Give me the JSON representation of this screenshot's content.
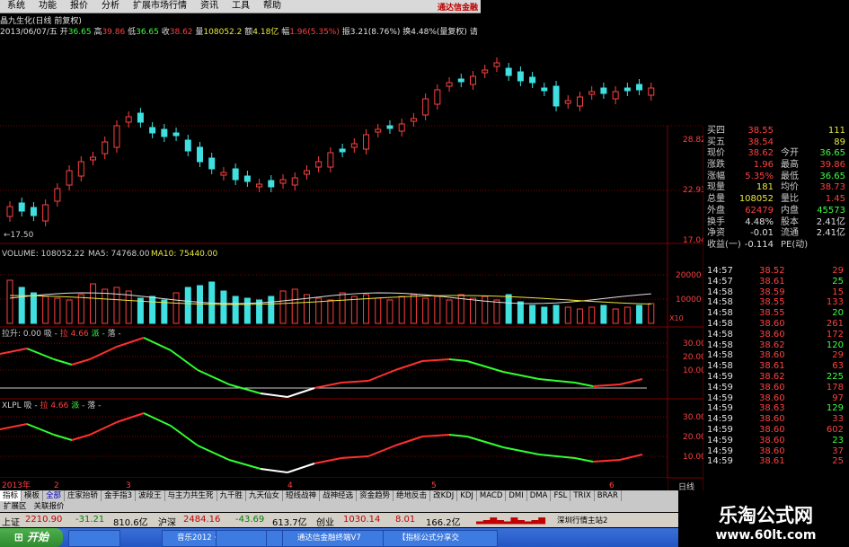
{
  "menu": {
    "items": [
      "系统",
      "功能",
      "报价",
      "分析",
      "扩展市场行情",
      "资讯",
      "工具",
      "帮助"
    ],
    "brand": "通达信金融"
  },
  "infoline": {
    "name": "晶九生化(日线 前复权)",
    "date": "2013/06/07/五",
    "open_label": "开",
    "open": "36.65",
    "high_label": "高",
    "high": "39.86",
    "low_label": "低",
    "low": "36.65",
    "close_label": "收",
    "close": "38.62",
    "vol_label": "量",
    "vol": "108052.2",
    "amt_label": "额",
    "amt": "4.18亿",
    "pct_label": "幅",
    "pct": "1.96(5.35%)",
    "amp_label": "振",
    "amp": "3.21(8.76%)",
    "turn_label": "换",
    "turn": "4.48%(量复权)",
    "extra": "请"
  },
  "price_axis": [
    "28.82",
    "22.93",
    "17.04"
  ],
  "low_label": "←17.50",
  "volume_line": {
    "label": "VOLUME: 108052.22",
    "ma5": "MA5: 74768.00",
    "ma10": "MA10: 75440.00"
  },
  "volume_axis": [
    "20000",
    "10000",
    "X10"
  ],
  "ind1": {
    "label_a": "拉升: 0.00",
    "label_b": "吸 -",
    "label_c": "拉 4.66",
    "label_d": "派 -",
    "label_e": "落 -"
  },
  "ind1_axis": [
    "30.00",
    "20.00",
    "10.00"
  ],
  "ind2": {
    "label_a": "XLPL",
    "label_b": "吸 -",
    "label_c": "拉 4.66",
    "label_d": "派 -",
    "label_e": "落 -"
  },
  "ind2_axis": [
    "30.00",
    "20.00",
    "10.00"
  ],
  "time_axis": [
    "2013年",
    "2",
    "3",
    "4",
    "5",
    "6"
  ],
  "quotes": {
    "rows": [
      {
        "label": "买四",
        "value": "38.55",
        "vol": "111"
      },
      {
        "label": "买五",
        "value": "38.54",
        "vol": "89"
      },
      {
        "label": "现价",
        "value": "38.62",
        "label2": "今开",
        "value2": "36.65"
      },
      {
        "label": "涨跌",
        "value": "1.96",
        "label2": "最高",
        "value2": "39.86"
      },
      {
        "label": "涨幅",
        "value": "5.35%",
        "label2": "最低",
        "value2": "36.65"
      },
      {
        "label": "现量",
        "value": "181",
        "label2": "均价",
        "value2": "38.73"
      },
      {
        "label": "总量",
        "value": "108052",
        "label2": "量比",
        "value2": "1.45"
      },
      {
        "label": "外盘",
        "value": "62479",
        "label2": "内盘",
        "value2": "45573"
      },
      {
        "label": "换手",
        "value": "4.48%",
        "label2": "股本",
        "value2": "2.41亿"
      },
      {
        "label": "净资",
        "value": "-0.01",
        "label2": "流通",
        "value2": "2.41亿"
      },
      {
        "label": "收益(一)",
        "value": "-0.114",
        "label2": "PE(动)",
        "value2": ""
      }
    ]
  },
  "ticks": [
    {
      "time": "14:57",
      "price": "38.52",
      "vol": "29"
    },
    {
      "time": "14:57",
      "price": "38.61",
      "vol": "25"
    },
    {
      "time": "14:58",
      "price": "38.59",
      "vol": "15"
    },
    {
      "time": "14:58",
      "price": "38.55",
      "vol": "133"
    },
    {
      "time": "14:58",
      "price": "38.55",
      "vol": "20"
    },
    {
      "time": "14:58",
      "price": "38.60",
      "vol": "261"
    },
    {
      "time": "14:58",
      "price": "38.60",
      "vol": "172"
    },
    {
      "time": "14:58",
      "price": "38.62",
      "vol": "120"
    },
    {
      "time": "14:58",
      "price": "38.60",
      "vol": "29"
    },
    {
      "time": "14:58",
      "price": "38.61",
      "vol": "63"
    },
    {
      "time": "14:59",
      "price": "38.62",
      "vol": "225"
    },
    {
      "time": "14:59",
      "price": "38.60",
      "vol": "178"
    },
    {
      "time": "14:59",
      "price": "38.60",
      "vol": "97"
    },
    {
      "time": "14:59",
      "price": "38.63",
      "vol": "129"
    },
    {
      "time": "14:59",
      "price": "38.60",
      "vol": "33"
    },
    {
      "time": "14:59",
      "price": "38.60",
      "vol": "602"
    },
    {
      "time": "14:59",
      "price": "38.60",
      "vol": "23"
    },
    {
      "time": "14:59",
      "price": "38.60",
      "vol": "37"
    },
    {
      "time": "14:59",
      "price": "38.61",
      "vol": "25"
    }
  ],
  "tabs": [
    "指标",
    "模板",
    "全部",
    "庄家抬轿",
    "金手指3",
    "波段王",
    "与主力共生死",
    "九千胜",
    "九天仙女",
    "短线战神",
    "战神经选",
    "资金趋势",
    "绝地反击",
    "改KDJ",
    "KDJ",
    "MACD",
    "DMI",
    "DMA",
    "FSL",
    "TRIX",
    "BRAR"
  ],
  "subtabs": [
    "扩展区",
    "关联报价"
  ],
  "status": {
    "sh_label": "上证",
    "sh": "2210.90",
    "sh_chg": "-31.21",
    "sh_amt": "810.6亿",
    "hs_label": "沪深",
    "hs": "2484.16",
    "hs_chg": "-43.69",
    "hs_amt": "613.7亿",
    "cy_label": "创业",
    "cy": "1030.14",
    "cy_chg": "8.01",
    "cy_amt": "166.2亿",
    "server": "深圳行情主站2"
  },
  "taskbar": {
    "start": "开始",
    "tasks": [
      "音乐2012 · 李代沫",
      "",
      "",
      "通达信金融终端V7",
      "【指标公式分享交"
    ]
  },
  "daytab": "日线",
  "watermark": {
    "line1": "乐淘公式网",
    "line2": "www.60lt.com"
  },
  "colors": {
    "up": "#ff4040",
    "down": "#40e0e0",
    "bg": "#000000",
    "grid": "#800000"
  }
}
